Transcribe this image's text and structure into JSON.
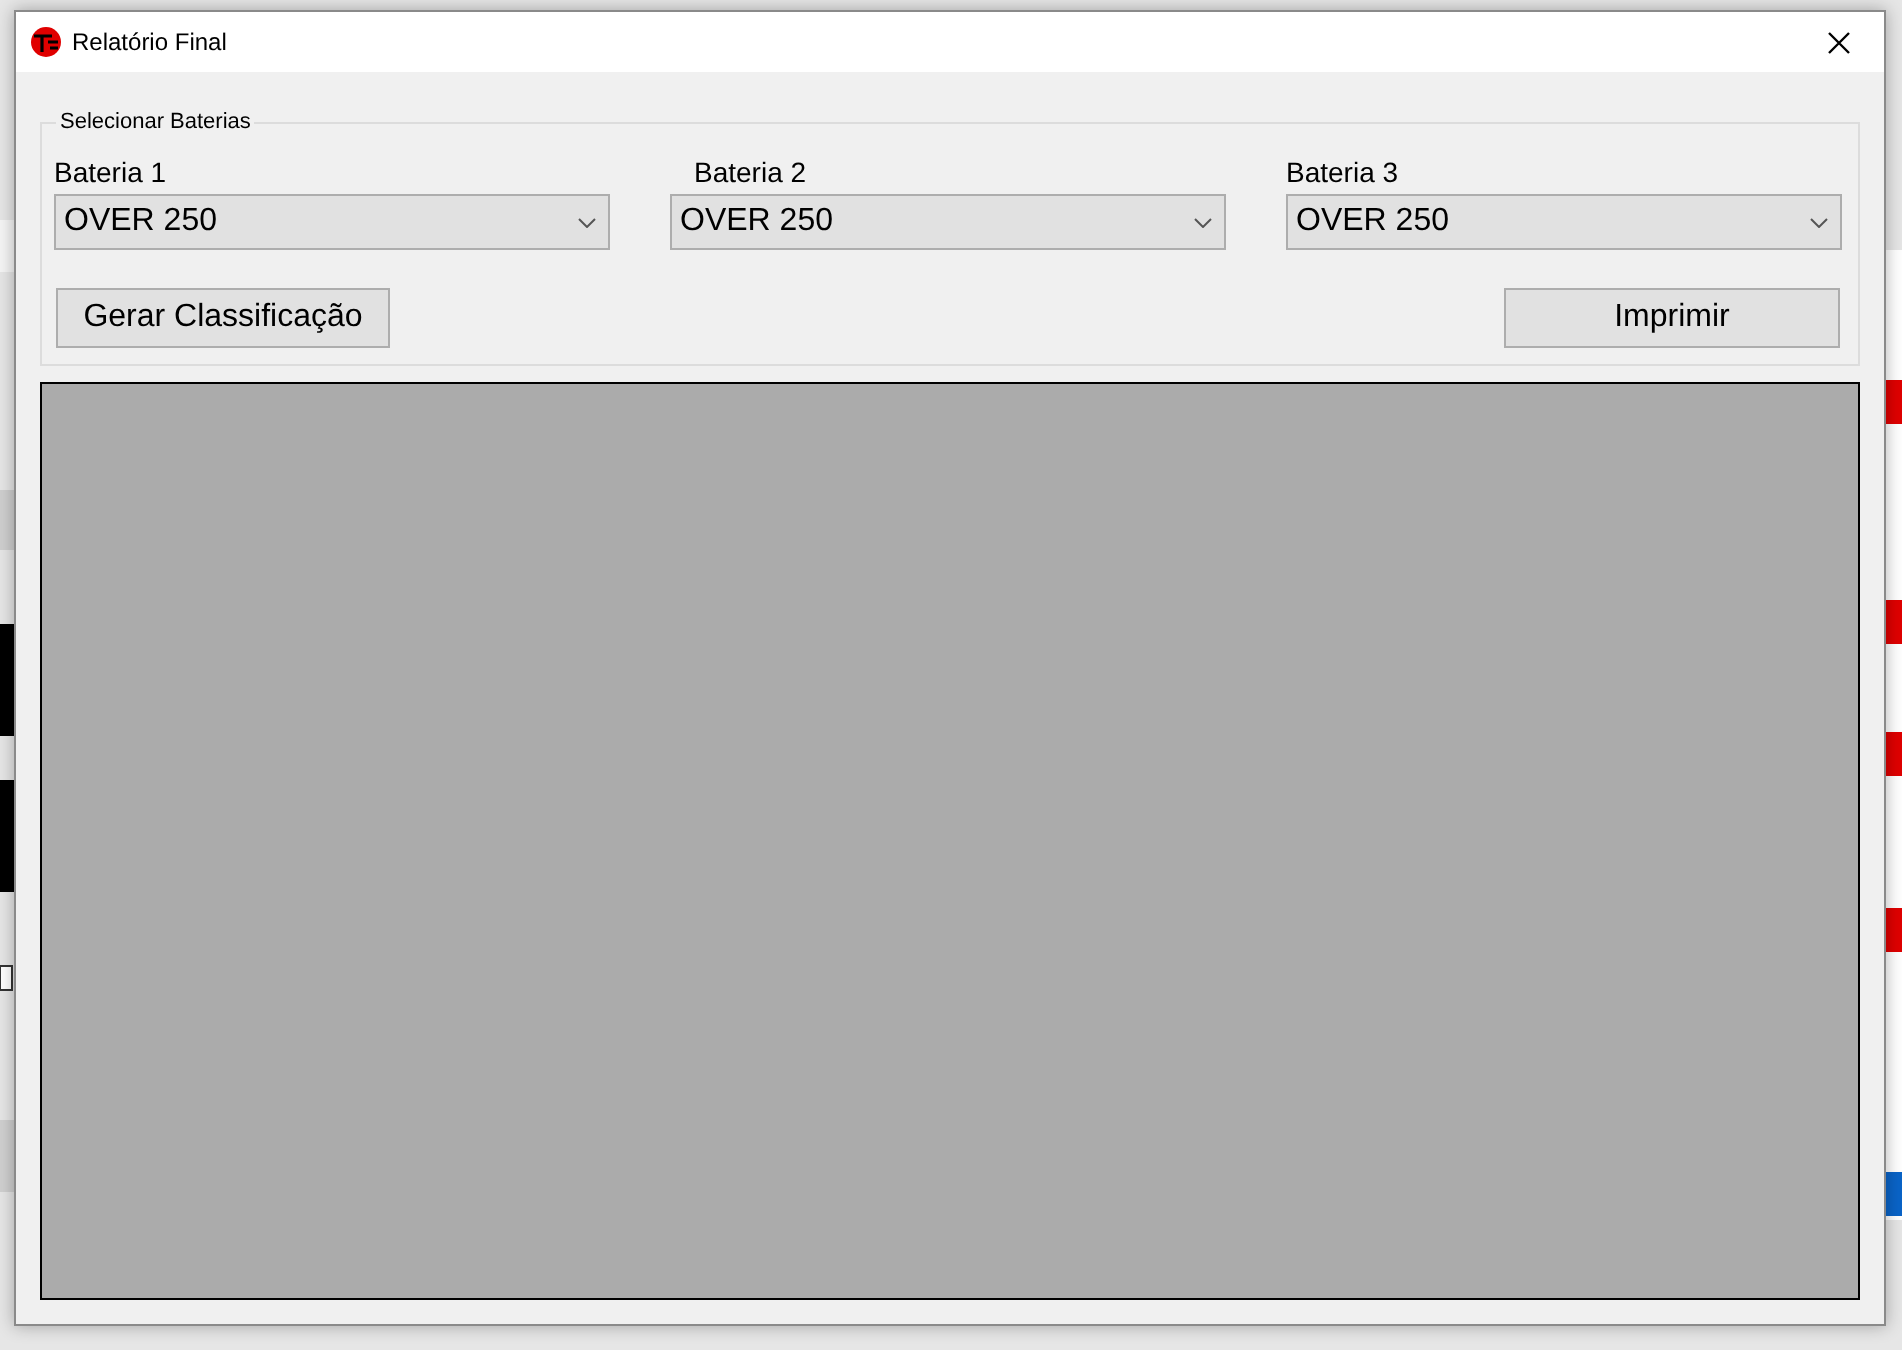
{
  "window": {
    "title": "Relatório Final"
  },
  "group": {
    "title": "Selecionar Baterias"
  },
  "selectors": [
    {
      "label": "Bateria 1",
      "value": "OVER 250"
    },
    {
      "label": "Bateria 2",
      "value": "OVER 250"
    },
    {
      "label": "Bateria 3",
      "value": "OVER 250"
    }
  ],
  "buttons": [
    "Gerar Classificação",
    "Imprimir"
  ]
}
